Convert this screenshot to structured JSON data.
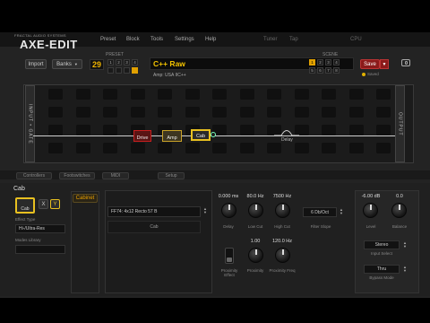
{
  "app": {
    "brand_small": "FRACTAL AUDIO SYSTEMS",
    "title": "AXE-EDIT"
  },
  "menu": {
    "items": [
      "Preset",
      "Block",
      "Tools",
      "Settings",
      "Help"
    ],
    "right_items": [
      "Tuner",
      "Tap",
      "CPU"
    ]
  },
  "toolbar": {
    "import": "Import",
    "banks": "Banks",
    "preset_number": "29",
    "preset_label": "PRESET",
    "scene_label": "SCENE",
    "save": "Save",
    "saved_label": "Saved",
    "preset_name": "C++ Raw",
    "amp_line": "Amp: USA IIC++",
    "preset_nums": [
      "1",
      "2",
      "3",
      "4"
    ],
    "scene_nums": [
      "1",
      "2",
      "3",
      "4",
      "5",
      "6",
      "7",
      "8"
    ]
  },
  "grid": {
    "input_label": "INPUT • GATE",
    "output_label": "OUTPUT",
    "blocks": [
      {
        "label": "Drive",
        "color": "#c81e1e"
      },
      {
        "label": "Amp",
        "color": "#c9a227"
      },
      {
        "label": "Cab",
        "color": "#e8c020"
      }
    ],
    "delay_label": "Delay"
  },
  "tabs": [
    "Controllers",
    "Footswitches",
    "MIDI",
    "Setup"
  ],
  "block_editor": {
    "block_name": "Cab",
    "x_label": "X",
    "y_label": "Y",
    "effect_type_label": "Effect Type",
    "effect_type_value": "Hi-/Ultra-Res",
    "modes_label": "Modes Library",
    "cabinet_tab": "Cabinet",
    "ir_name": "FF74: 4x12 Recto 57 B",
    "ir_slot_label": "Cab",
    "knobs": [
      {
        "value": "0.000 ms",
        "label": "Delay"
      },
      {
        "value": "80.0 Hz",
        "label": "Low Cut"
      },
      {
        "value": "7500 Hz",
        "label": "High Cut"
      },
      {
        "value": "1.00",
        "label": "Proximity"
      },
      {
        "value": "120.0 Hz",
        "label": "Proximity Freq"
      }
    ],
    "filter_slope_value": "6 Db/Oct",
    "filter_slope_label": "Filter Slope",
    "proximity_effect_label": "Proximity Effect",
    "level_value": "-6.00 dB",
    "level_label": "Level",
    "balance_value": "0.0",
    "balance_label": "Balance",
    "input_select_value": "Stereo",
    "input_select_label": "Input Select",
    "bypass_value": "Thru",
    "bypass_label": "Bypass Mode"
  }
}
